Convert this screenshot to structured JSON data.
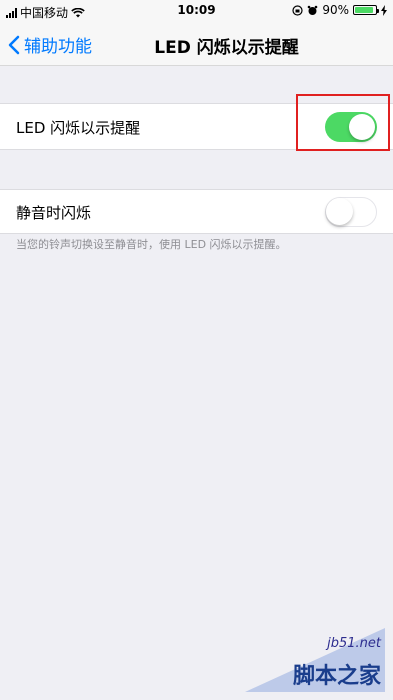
{
  "status_bar": {
    "carrier": "中国移动",
    "time": "10:09",
    "battery": "90%",
    "battery_level": 0.9
  },
  "nav": {
    "back_label": "辅助功能",
    "title": "LED 闪烁以示提醒"
  },
  "settings": {
    "led_flash": {
      "label": "LED 闪烁以示提醒",
      "on": true
    },
    "flash_on_silent": {
      "label": "静音时闪烁",
      "on": false
    },
    "footer": "当您的铃声切换设至静音时，使用 LED 闪烁以示提醒。"
  },
  "watermark": {
    "url": "jb51.net",
    "text": "脚本之家"
  },
  "colors": {
    "accent": "#007aff",
    "toggle_on": "#4cd964",
    "highlight": "#e02020"
  }
}
